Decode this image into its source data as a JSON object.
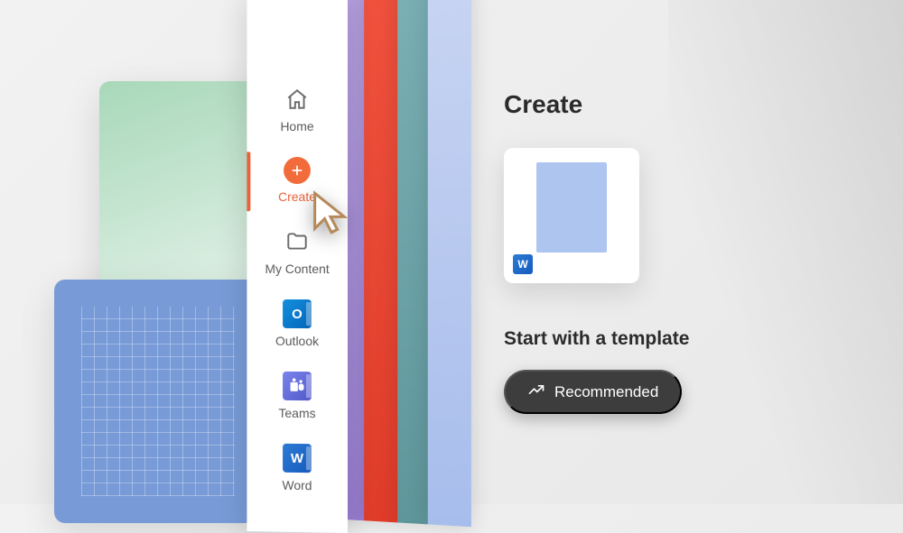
{
  "sidebar": {
    "items": [
      {
        "id": "home",
        "label": "Home",
        "icon": "home-icon"
      },
      {
        "id": "create",
        "label": "Create",
        "icon": "plus-icon",
        "selected": true
      },
      {
        "id": "my-content",
        "label": "My Content",
        "icon": "folder-icon"
      },
      {
        "id": "outlook",
        "label": "Outlook",
        "icon": "outlook-app-icon",
        "glyph": "O"
      },
      {
        "id": "teams",
        "label": "Teams",
        "icon": "teams-app-icon"
      },
      {
        "id": "word",
        "label": "Word",
        "icon": "word-app-icon",
        "glyph": "W"
      }
    ]
  },
  "main": {
    "title": "Create",
    "document_card": {
      "app": "Word",
      "badge_glyph": "W"
    },
    "template_heading": "Start with a template",
    "recommended_button": "Recommended"
  },
  "colors": {
    "accent": "#e8623a",
    "word": "#185abd",
    "outlook": "#0364b8",
    "teams": "#5059c9"
  }
}
